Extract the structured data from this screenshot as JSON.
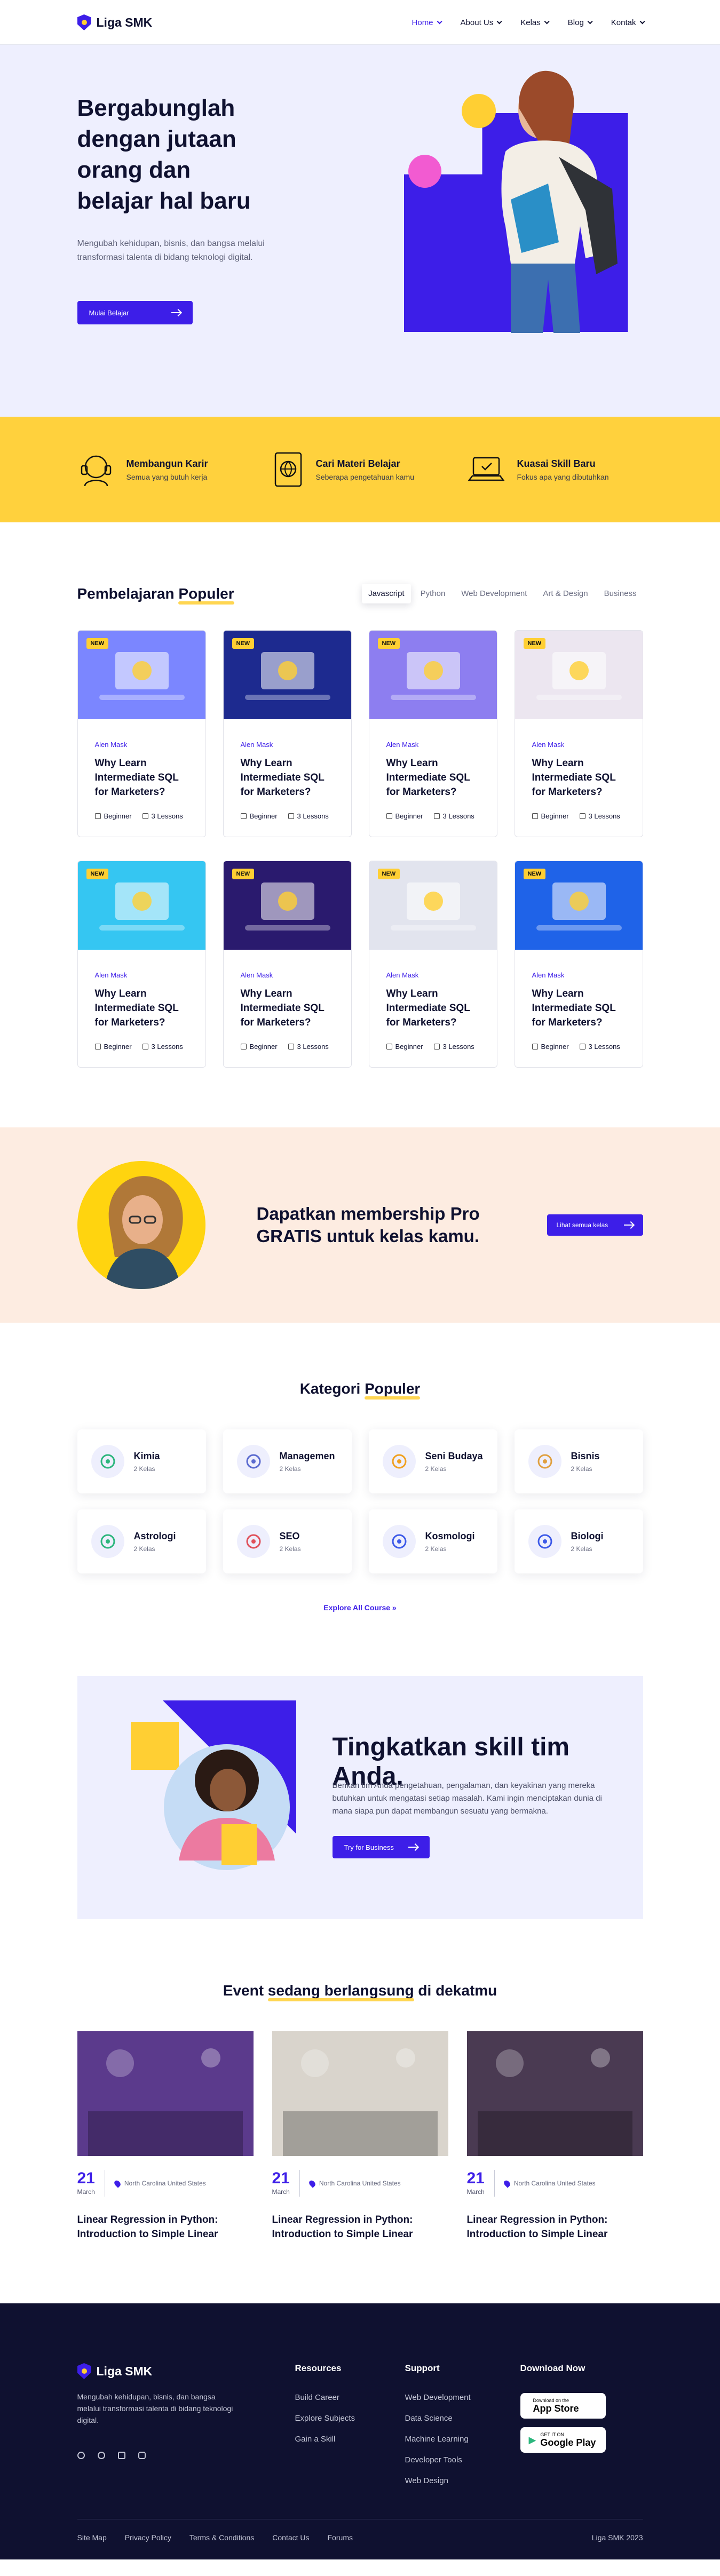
{
  "brand": {
    "name": "Liga SMK"
  },
  "nav": [
    {
      "label": "Home"
    },
    {
      "label": "About Us"
    },
    {
      "label": "Kelas"
    },
    {
      "label": "Blog"
    },
    {
      "label": "Kontak"
    }
  ],
  "hero": {
    "title": "Bergabunglah dengan jutaan orang dan belajar hal baru",
    "subtitle": "Mengubah kehidupan, bisnis, dan bangsa melalui transformasi talenta di bidang teknologi digital.",
    "cta": "Mulai Belajar"
  },
  "features": [
    {
      "icon": "headset-icon",
      "title": "Membangun Karir",
      "desc": "Semua yang butuh kerja"
    },
    {
      "icon": "globe-tablet-icon",
      "title": "Cari Materi Belajar",
      "desc": "Seberapa pengetahuan kamu"
    },
    {
      "icon": "laptop-icon",
      "title": "Kuasai Skill Baru",
      "desc": "Fokus apa yang dibutuhkan"
    }
  ],
  "courses": {
    "title_a": "Pembelajaran",
    "title_b": "Populer",
    "filters": [
      "Javascript",
      "Python",
      "Web Development",
      "Art & Design",
      "Business"
    ],
    "items": [
      {
        "tag": "NEW",
        "author": "Alen Mask",
        "title": "Why Learn Intermediate SQL for Marketers?",
        "level": "Beginner",
        "lessons": "3 Lessons",
        "bg": "#7b86ff"
      },
      {
        "tag": "NEW",
        "author": "Alen Mask",
        "title": "Why Learn Intermediate SQL for Marketers?",
        "level": "Beginner",
        "lessons": "3 Lessons",
        "bg": "#1d2a8f"
      },
      {
        "tag": "NEW",
        "author": "Alen Mask",
        "title": "Why Learn Intermediate SQL for Marketers?",
        "level": "Beginner",
        "lessons": "3 Lessons",
        "bg": "#8d7ef0"
      },
      {
        "tag": "NEW",
        "author": "Alen Mask",
        "title": "Why Learn Intermediate SQL for Marketers?",
        "level": "Beginner",
        "lessons": "3 Lessons",
        "bg": "#ece6f0"
      },
      {
        "tag": "NEW",
        "author": "Alen Mask",
        "title": "Why Learn Intermediate SQL for Marketers?",
        "level": "Beginner",
        "lessons": "3 Lessons",
        "bg": "#35c6f2"
      },
      {
        "tag": "NEW",
        "author": "Alen Mask",
        "title": "Why Learn Intermediate SQL for Marketers?",
        "level": "Beginner",
        "lessons": "3 Lessons",
        "bg": "#2a1a6e"
      },
      {
        "tag": "NEW",
        "author": "Alen Mask",
        "title": "Why Learn Intermediate SQL for Marketers?",
        "level": "Beginner",
        "lessons": "3 Lessons",
        "bg": "#e2e4ee"
      },
      {
        "tag": "NEW",
        "author": "Alen Mask",
        "title": "Why Learn Intermediate SQL for Marketers?",
        "level": "Beginner",
        "lessons": "3 Lessons",
        "bg": "#1f63e8"
      }
    ]
  },
  "membership": {
    "title": "Dapatkan membership Pro GRATIS untuk kelas kamu.",
    "cta": "Lihat semua kelas"
  },
  "categories": {
    "title_a": "Kategori",
    "title_b": "Populer",
    "explore": "Explore All Course",
    "items": [
      {
        "name": "Kimia",
        "count": "2 Kelas",
        "icon": "flask-icon",
        "color": "#2cb67d"
      },
      {
        "name": "Managemen",
        "count": "2 Kelas",
        "icon": "calendar-icon",
        "color": "#5a6acf"
      },
      {
        "name": "Seni Budaya",
        "count": "2 Kelas",
        "icon": "paint-icon",
        "color": "#f0a020"
      },
      {
        "name": "Bisnis",
        "count": "2 Kelas",
        "icon": "briefcase-icon",
        "color": "#e0a040"
      },
      {
        "name": "Astrologi",
        "count": "2 Kelas",
        "icon": "atom-icon",
        "color": "#2cb67d"
      },
      {
        "name": "SEO",
        "count": "2 Kelas",
        "icon": "rocket-icon",
        "color": "#e0505a"
      },
      {
        "name": "Kosmologi",
        "count": "2 Kelas",
        "icon": "planet-icon",
        "color": "#3d5ae8"
      },
      {
        "name": "Biologi",
        "count": "2 Kelas",
        "icon": "microscope-icon",
        "color": "#3d5ae8"
      }
    ]
  },
  "team": {
    "title": "Tingkatkan skill tim Anda.",
    "desc": "Berikan tim Anda pengetahuan, pengalaman, dan keyakinan yang mereka butuhkan untuk mengatasi setiap masalah. Kami ingin menciptakan dunia di mana siapa pun dapat membangun sesuatu yang bermakna.",
    "cta": "Try for Business"
  },
  "events": {
    "title_a": "Event",
    "title_b": "sedang berlangsung",
    "title_c": "di dekatmu",
    "items": [
      {
        "day": "21",
        "month": "March",
        "location": "North Carolina United States",
        "title": "Linear Regression in Python: Introduction to Simple Linear",
        "bg": "#5b3a8c"
      },
      {
        "day": "21",
        "month": "March",
        "location": "North Carolina United States",
        "title": "Linear Regression in Python: Introduction to Simple Linear",
        "bg": "#d9d4cc"
      },
      {
        "day": "21",
        "month": "March",
        "location": "North Carolina United States",
        "title": "Linear Regression in Python: Introduction to Simple Linear",
        "bg": "#4a3a52"
      }
    ]
  },
  "footer": {
    "desc": "Mengubah kehidupan, bisnis, dan bangsa melalui transformasi talenta di bidang teknologi digital.",
    "resources": {
      "title": "Resources",
      "links": [
        "Build Career",
        "Explore Subjects",
        "Gain a Skill"
      ]
    },
    "support": {
      "title": "Support",
      "links": [
        "Web Development",
        "Data Science",
        "Machine Learning",
        "Developer Tools",
        "Web Design"
      ]
    },
    "download": {
      "title": "Download Now",
      "appstore_small": "Download on the",
      "appstore": "App Store",
      "gplay_small": "GET IT ON",
      "gplay": "Google Play"
    },
    "bottom_links": [
      "Site Map",
      "Privacy Policy",
      "Terms & Conditions",
      "Contact Us",
      "Forums"
    ],
    "copyright": "Liga SMK 2023"
  },
  "colors": {
    "primary": "#3d1ee8",
    "accent": "#ffd13d",
    "dark": "#0f1130"
  }
}
